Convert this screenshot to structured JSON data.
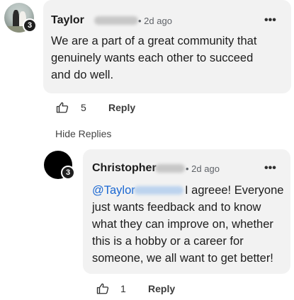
{
  "comments": [
    {
      "author": "Taylor",
      "time": "2d ago",
      "badge": "3",
      "text": "We are a part of a great community that genuinely wants each other to succeed and do well.",
      "likes": "5",
      "reply_label": "Reply",
      "more_label": "•••"
    }
  ],
  "hide_replies_label": "Hide Replies",
  "replies": [
    {
      "author": "Christopher",
      "time": "2d ago",
      "badge": "3",
      "mention": "@Taylor",
      "text": "I agreee! Everyone just wants feedback and to know what they can improve on, whether this is a hobby or a career for someone, we all want to get better!",
      "likes": "1",
      "reply_label": "Reply",
      "more_label": "•••"
    }
  ],
  "colors": {
    "bubble": "#f2f2f2",
    "mention": "#1967d2",
    "badge": "#1f1f1f"
  }
}
